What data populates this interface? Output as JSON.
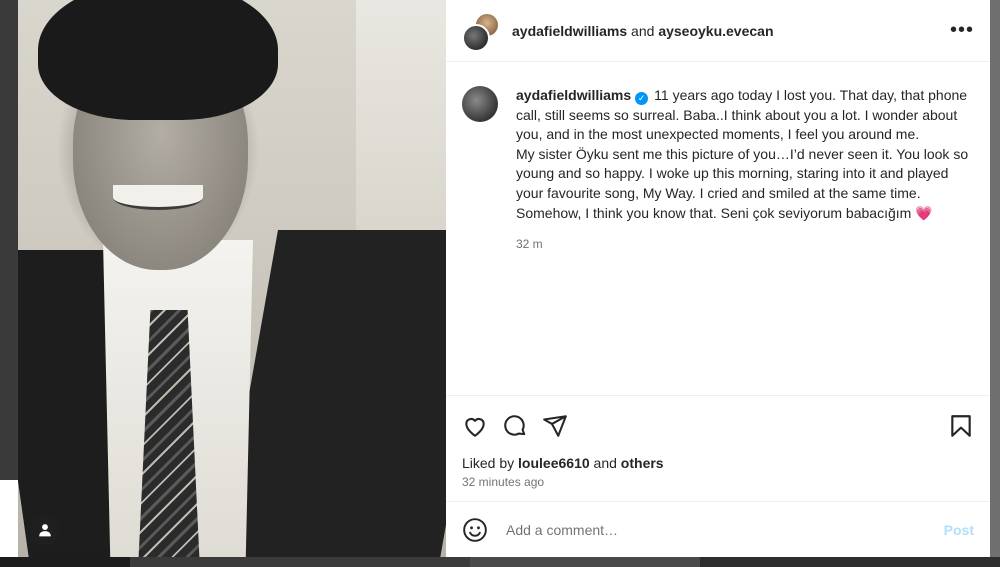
{
  "header": {
    "user1": "aydafieldwilliams",
    "joiner": " and ",
    "user2": "ayseoyku.evecan",
    "more_label": "•••"
  },
  "caption": {
    "username": "aydafieldwilliams",
    "text_1": "11 years ago today I lost you. That day, that phone call, still seems so surreal. Baba..I think about you a lot. I wonder about you, and in the most unexpected moments, I feel you around me.",
    "text_2": "My sister Öyku sent me this picture of you…I’d never seen it. You look so young and so happy. I woke up this morning, staring into it and played your favourite song, My Way. I cried and smiled at the same time. Somehow, I think you know that. Seni çok seviyorum babacığım",
    "emoji": "💗",
    "time": "32 m"
  },
  "likes": {
    "prefix": "Liked by ",
    "user": "loulee6610",
    "middle": " and ",
    "others": "others"
  },
  "posted_ago": "32 minutes ago",
  "comment": {
    "placeholder": "Add a comment…",
    "post_label": "Post"
  },
  "icons": [
    "heart-icon",
    "comment-icon",
    "share-icon",
    "bookmark-icon",
    "emoji-icon",
    "more-icon",
    "verified-icon",
    "user-icon"
  ],
  "colors": {
    "verified": "#0095f6",
    "post_disabled": "#b2dffc",
    "muted_text": "#737373"
  }
}
